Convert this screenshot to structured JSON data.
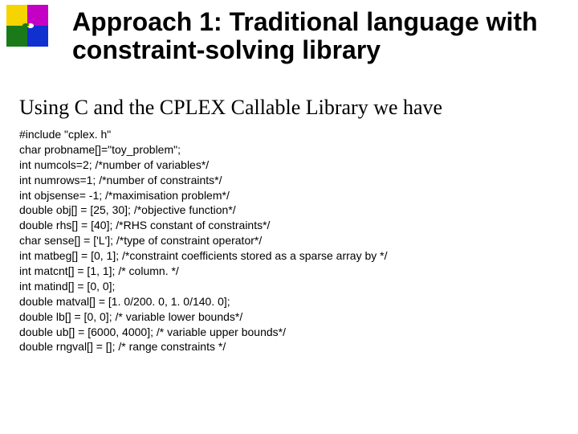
{
  "title": "Approach 1: Traditional language with constraint-solving library",
  "subtitle": "Using C and the CPLEX Callable Library we have",
  "code_lines": [
    "#include \"cplex. h\"",
    "char probname[]=\"toy_problem\";",
    "int numcols=2; /*number of variables*/",
    "int numrows=1; /*number of constraints*/",
    "int objsense= -1; /*maximisation problem*/",
    "double obj[] = [25, 30]; /*objective function*/",
    "double rhs[] = [40]; /*RHS constant of constraints*/",
    "char sense[] = ['L']; /*type of constraint operator*/",
    "int matbeg[] = [0, 1]; /*constraint coefficients stored as a sparse array by */",
    "int matcnt[] = [1, 1]; /* column. */",
    "int matind[] = [0, 0];",
    "double matval[] = [1. 0/200. 0, 1. 0/140. 0];",
    "double lb[] = [0, 0]; /* variable lower bounds*/",
    "double ub[] = [6000, 4000]; /* variable upper bounds*/",
    "double rngval[] = []; /* range constraints */"
  ]
}
